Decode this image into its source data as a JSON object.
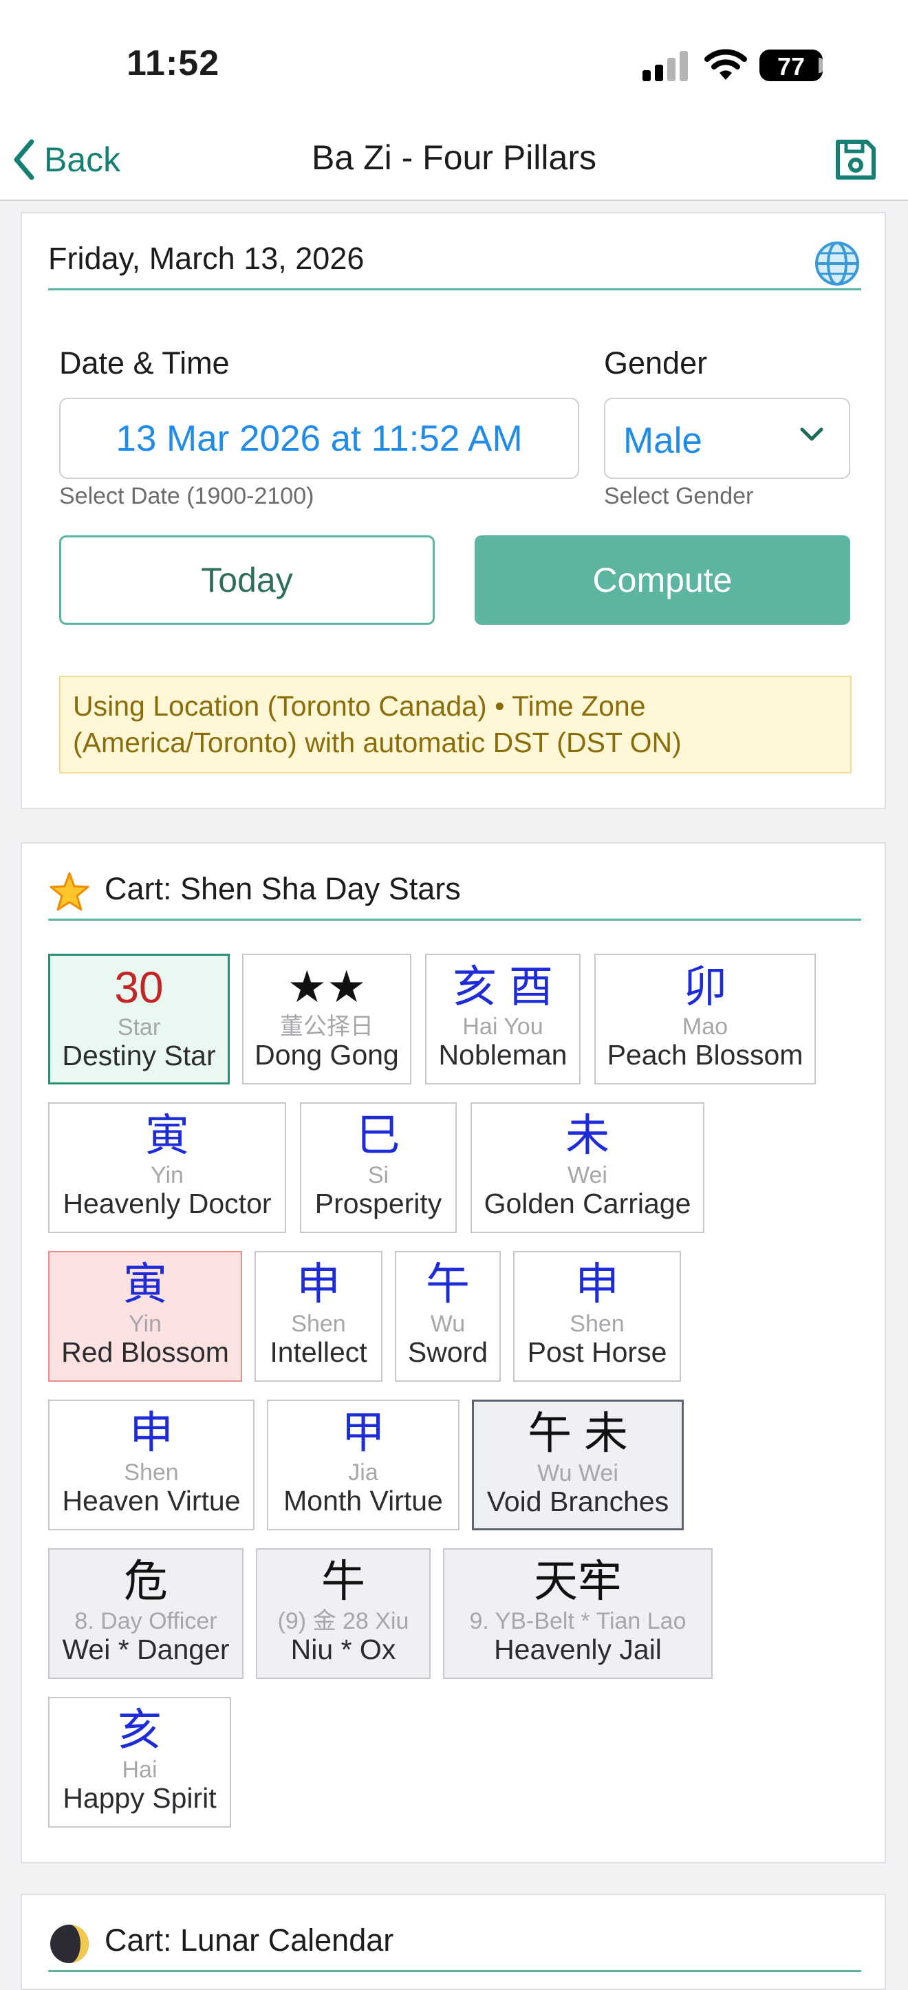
{
  "status": {
    "time": "11:52",
    "battery": "77"
  },
  "nav": {
    "back_label": "Back",
    "title": "Ba Zi - Four Pillars"
  },
  "form_card": {
    "date_heading": "Friday, March 13, 2026",
    "date_time_label": "Date & Time",
    "date_value": "13 Mar 2026 at 11:52 AM",
    "date_hint": "Select Date (1900-2100)",
    "gender_label": "Gender",
    "gender_value": "Male",
    "gender_hint": "Select Gender",
    "today_label": "Today",
    "compute_label": "Compute",
    "location_note": "Using Location (Toronto Canada) • Time Zone (America/Toronto) with automatic DST (DST ON)"
  },
  "stars_card": {
    "title": "Cart: Shen Sha Day Stars",
    "tiles": [
      {
        "main": "30",
        "sub": "Star",
        "name": "Destiny Star"
      },
      {
        "main": "★★",
        "sub": "董公择日",
        "name": "Dong Gong"
      },
      {
        "main": "亥 酉",
        "sub": "Hai You",
        "name": "Nobleman"
      },
      {
        "main": "卯",
        "sub": "Mao",
        "name": "Peach Blossom"
      },
      {
        "main": "寅",
        "sub": "Yin",
        "name": "Heavenly Doctor"
      },
      {
        "main": "巳",
        "sub": "Si",
        "name": "Prosperity"
      },
      {
        "main": "未",
        "sub": "Wei",
        "name": "Golden Carriage"
      },
      {
        "main": "寅",
        "sub": "Yin",
        "name": "Red Blossom"
      },
      {
        "main": "申",
        "sub": "Shen",
        "name": "Intellect"
      },
      {
        "main": "午",
        "sub": "Wu",
        "name": "Sword"
      },
      {
        "main": "申",
        "sub": "Shen",
        "name": "Post Horse"
      },
      {
        "main": "申",
        "sub": "Shen",
        "name": "Heaven Virtue"
      },
      {
        "main": "甲",
        "sub": "Jia",
        "name": "Month Virtue"
      },
      {
        "main": "午 未",
        "sub": "Wu Wei",
        "name": "Void Branches"
      },
      {
        "main": "危",
        "sub": "8. Day Officer",
        "name": "Wei * Danger"
      },
      {
        "main": "牛",
        "sub": "(9) 金 28 Xiu",
        "name": "Niu * Ox"
      },
      {
        "main": "天牢",
        "sub": "9. YB-Belt * Tian Lao",
        "name": "Heavenly Jail"
      },
      {
        "main": "亥",
        "sub": "Hai",
        "name": "Happy Spirit"
      }
    ]
  },
  "lunar_card": {
    "title": "Cart: Lunar Calendar"
  },
  "colors": {
    "accent": "#5bb5a1",
    "link_blue": "#1f8bea",
    "char_blue": "#1d2bd8",
    "destiny_red": "#c42424"
  }
}
